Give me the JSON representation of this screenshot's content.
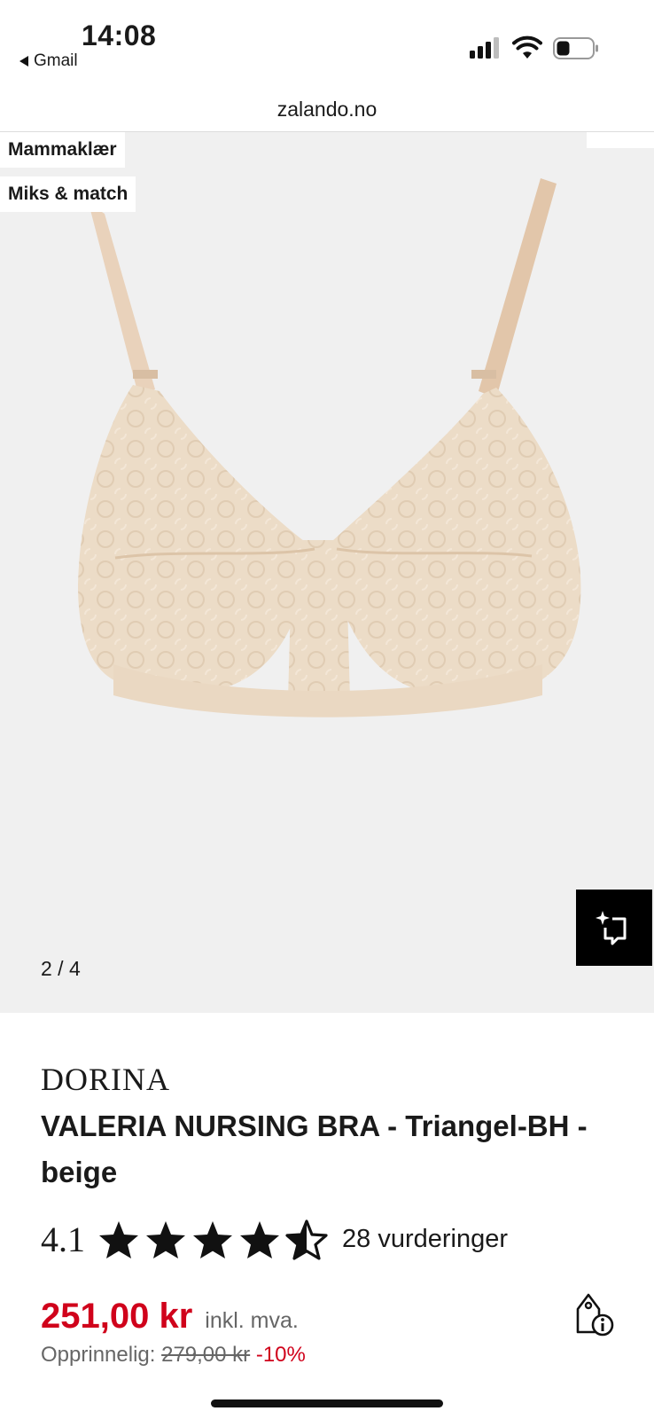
{
  "status_bar": {
    "time": "14:08",
    "back_app": "Gmail"
  },
  "browser": {
    "url": "zalando.no"
  },
  "gallery": {
    "tags": [
      "Mammaklær",
      "Miks & match"
    ],
    "counter": "2 / 4",
    "image": "beige-lace-nursing-bra",
    "virtual_tryon_icon": "sparkle-crop-icon"
  },
  "product": {
    "brand": "DORINA",
    "title": "VALERIA NURSING BRA - Triangel-BH - beige",
    "rating": "4.1",
    "rating_value": 4.1,
    "stars_max": 5,
    "reviews": "28 vurderinger",
    "price": "251,00 kr",
    "vat_note": "inkl. mva.",
    "original_label": "Opprinnelig:",
    "original_price": "279,00 kr",
    "discount": "-10%",
    "price_color": "#d0021b"
  }
}
